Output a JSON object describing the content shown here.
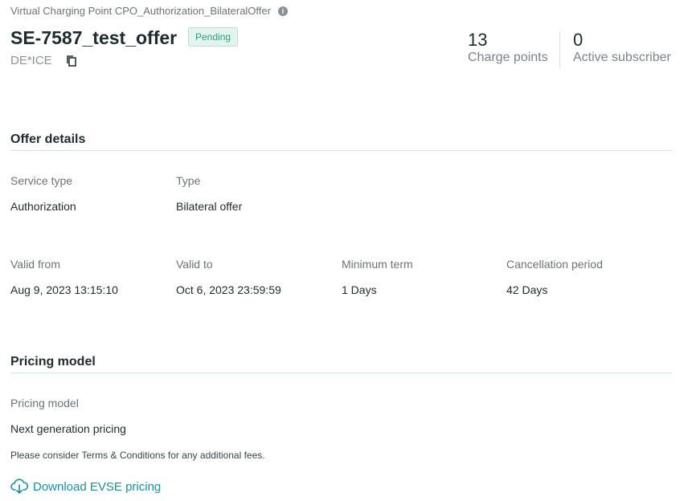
{
  "breadcrumb": {
    "text": "Virtual Charging Point CPO_Authorization_BilateralOffer",
    "icon": "info-icon"
  },
  "header": {
    "title": "SE-7587_test_offer",
    "status": "Pending",
    "operator": "DE*ICE",
    "copy_icon": "copy-icon"
  },
  "stats": [
    {
      "value": "13",
      "label": "Charge points"
    },
    {
      "value": "0",
      "label": "Active subscriber"
    }
  ],
  "offer_details": {
    "title": "Offer details",
    "service_type": {
      "label": "Service type",
      "value": "Authorization"
    },
    "type": {
      "label": "Type",
      "value": "Bilateral offer"
    },
    "valid_from": {
      "label": "Valid from",
      "value": "Aug 9, 2023 13:15:10"
    },
    "valid_to": {
      "label": "Valid to",
      "value": "Oct 6, 2023 23:59:59"
    },
    "minimum_term": {
      "label": "Minimum term",
      "value": "1 Days"
    },
    "cancellation_period": {
      "label": "Cancellation period",
      "value": "42 Days"
    }
  },
  "pricing": {
    "title": "Pricing model",
    "model_label": "Pricing model",
    "model_value": "Next generation pricing",
    "note": "Please consider Terms & Conditions for any additional fees.",
    "download_label": "Download EVSE pricing",
    "download_icon": "cloud-download-icon"
  },
  "colors": {
    "accent": "#1d8fa0",
    "badge_text": "#2e9c7c",
    "badge_bg": "#e3f3ee",
    "divider": "#cfe8e1"
  }
}
